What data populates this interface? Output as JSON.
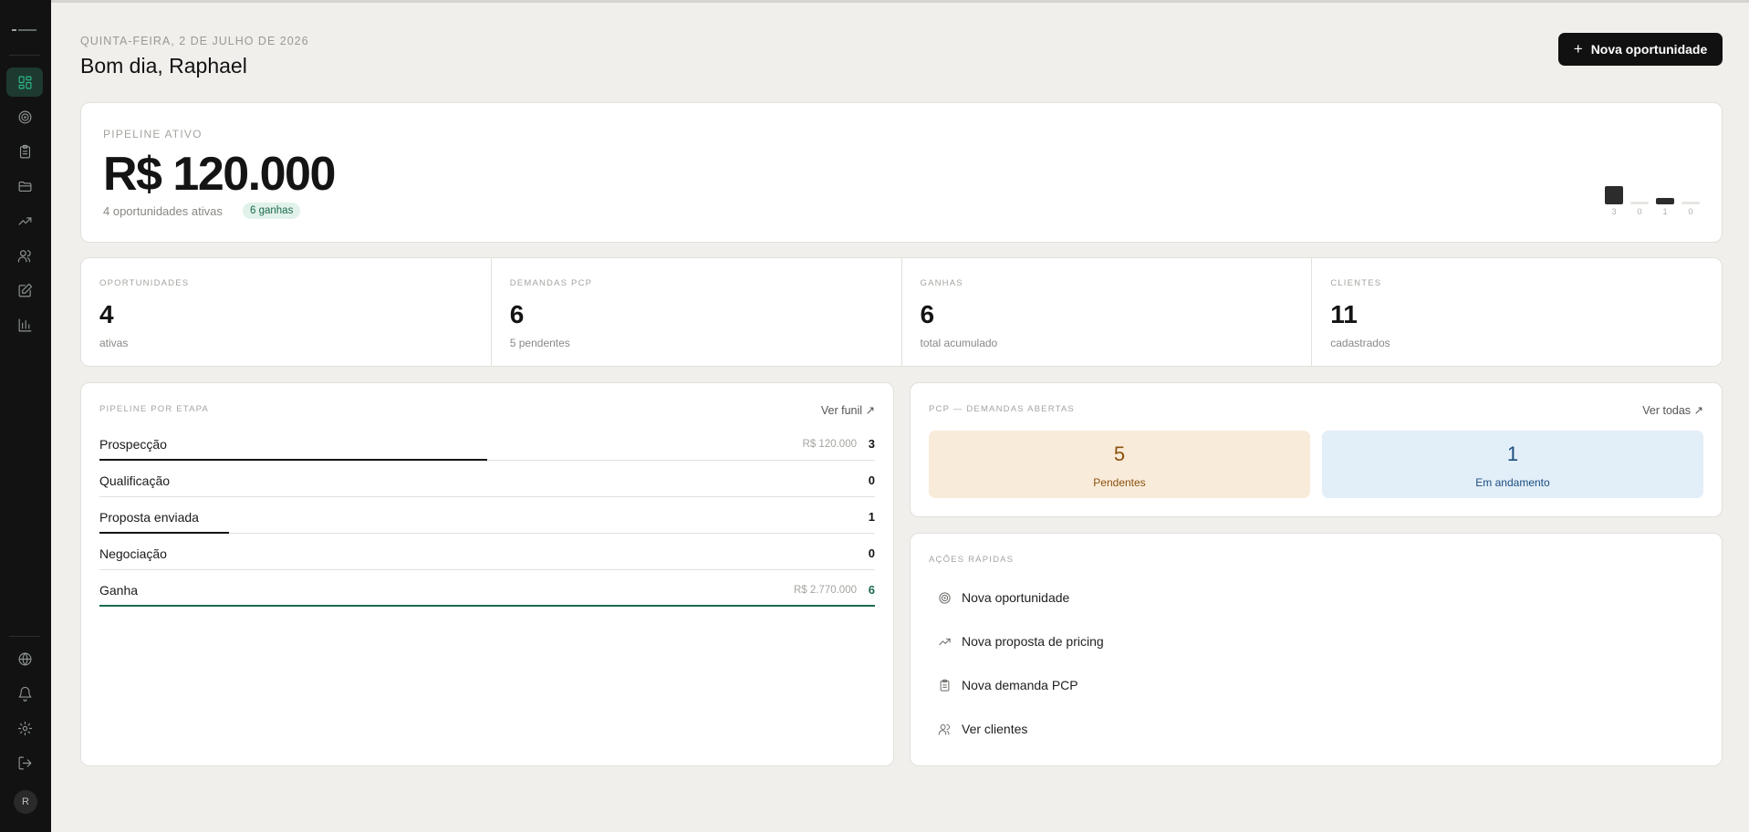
{
  "header": {
    "date": "QUINTA-FEIRA, 2 DE JULHO DE 2026",
    "greeting": "Bom dia, Raphael",
    "new_button": "Nova oportunidade"
  },
  "sidebar": {
    "avatar_initial": "R",
    "items": [
      {
        "name": "dashboard-icon",
        "active": true
      },
      {
        "name": "target-icon"
      },
      {
        "name": "clipboard-icon"
      },
      {
        "name": "folder-icon"
      },
      {
        "name": "trending-up-icon"
      },
      {
        "name": "users-icon"
      },
      {
        "name": "edit-icon"
      },
      {
        "name": "bar-chart-icon"
      }
    ],
    "bottom_items": [
      "globe-icon",
      "bell-icon",
      "settings-icon",
      "logout-icon"
    ]
  },
  "hero": {
    "label": "PIPELINE ATIVO",
    "value": "R$ 120.000",
    "subtitle": "4 oportunidades ativas",
    "badge": "6 ganhas",
    "mini_counts": [
      "3",
      "0",
      "1",
      "0"
    ],
    "mini_levels": [
      3,
      0,
      1,
      0
    ]
  },
  "stats": [
    {
      "label": "OPORTUNIDADES",
      "value": "4",
      "desc": "ativas"
    },
    {
      "label": "DEMANDAS PCP",
      "value": "6",
      "desc": "5 pendentes"
    },
    {
      "label": "GANHAS",
      "value": "6",
      "desc": "total acumulado"
    },
    {
      "label": "CLIENTES",
      "value": "11",
      "desc": "cadastrados"
    }
  ],
  "pipeline": {
    "title": "PIPELINE POR ETAPA",
    "link": "Ver funil ↗",
    "stages": [
      {
        "name": "Prospecção",
        "amount": "R$ 120.000",
        "count": "3",
        "fill_fraction": 0.5
      },
      {
        "name": "Qualificação",
        "amount": "",
        "count": "0",
        "fill_fraction": 0
      },
      {
        "name": "Proposta enviada",
        "amount": "",
        "count": "1",
        "fill_fraction": 0.1667
      },
      {
        "name": "Negociação",
        "amount": "",
        "count": "0",
        "fill_fraction": 0
      },
      {
        "name": "Ganha",
        "amount": "R$ 2.770.000",
        "count": "6",
        "fill_fraction": 1
      }
    ]
  },
  "pcp": {
    "title": "PCP — DEMANDAS ABERTAS",
    "link": "Ver todas ↗",
    "pending_count": "5",
    "pending_label": "Pendentes",
    "progress_count": "1",
    "progress_label": "Em andamento",
    "pending_color": "#8a520f",
    "progress_color": "#1b4d80"
  },
  "quick_actions": {
    "title": "AÇÕES RÁPIDAS",
    "items": [
      {
        "label": "Nova oportunidade",
        "icon": "target-icon"
      },
      {
        "label": "Nova proposta de pricing",
        "icon": "trending-up-icon"
      },
      {
        "label": "Nova demanda PCP",
        "icon": "clipboard-icon"
      },
      {
        "label": "Ver clientes",
        "icon": "users-icon"
      }
    ]
  },
  "colors": {
    "accent": "#1c6b4c",
    "sidebar_bg": "#121212",
    "page_bg": "#f1efeb"
  }
}
